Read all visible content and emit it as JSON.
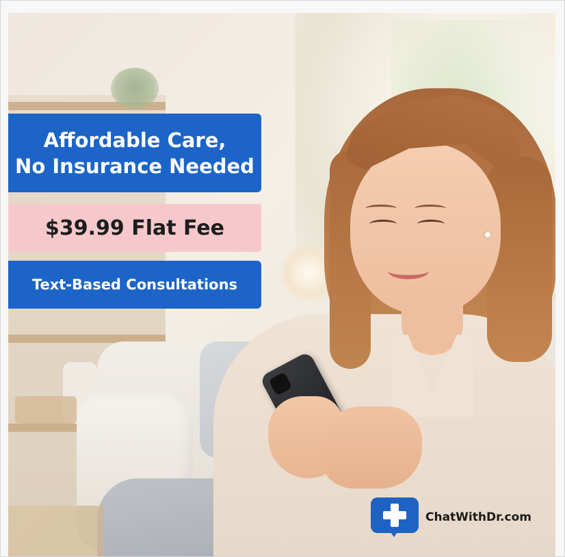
{
  "ad": {
    "headline_line1": "Affordable Care,",
    "headline_line2": "No Insurance Needed",
    "price_banner": "$39.99 Flat Fee",
    "feature_banner": "Text-Based Consultations",
    "brand_domain": "ChatWithDr.com",
    "logo_icon": "chat-plus-icon"
  },
  "colors": {
    "accent_blue": "#1c64c7",
    "accent_pink": "#f6c8cb",
    "text_dark": "#1d1d1d",
    "text_light": "#ffffff"
  }
}
